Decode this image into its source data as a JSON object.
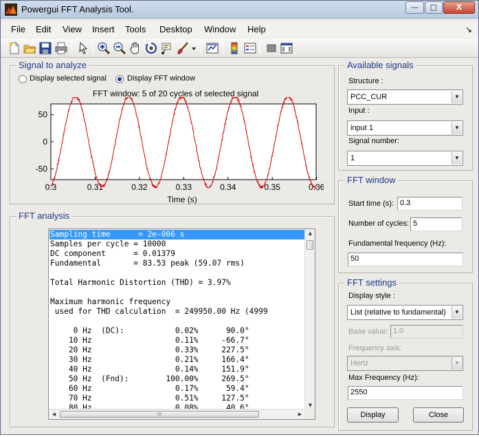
{
  "window": {
    "title": "Powergui FFT Analysis Tool.",
    "min_label": "—",
    "max_label": "□",
    "close_label": "X"
  },
  "menu": [
    "File",
    "Edit",
    "View",
    "Insert",
    "Tools",
    "Desktop",
    "Window",
    "Help"
  ],
  "menu_dock_glyph": "↘",
  "toolbar_icons": [
    "new-figure-icon",
    "open-file-icon",
    "save-icon",
    "print-icon",
    "pointer-icon",
    "zoom-in-icon",
    "zoom-out-icon",
    "pan-hand-icon",
    "rotate-3d-icon",
    "data-cursor-icon",
    "brush-icon",
    "brush-dropdown-icon",
    "link-plot-icon",
    "colorbar-icon",
    "legend-icon",
    "hide-plot-tools-icon",
    "show-plot-tools-icon"
  ],
  "signal_panel": {
    "legend": "Signal to analyze",
    "radio_selected_label": "Display selected signal",
    "radio_fft_label": "Display FFT window",
    "selected_option": "fft",
    "plot_title": "FFT window: 5 of 20 cycles of selected signal",
    "xlabel": "Time (s)"
  },
  "chart_data": {
    "type": "line",
    "title": "FFT window: 5 of 20 cycles of selected signal",
    "xlabel": "Time (s)",
    "ylabel": "",
    "xlim": [
      0.3,
      0.3599
    ],
    "ylim": [
      -70,
      70
    ],
    "xticks": [
      "0.3",
      "0.31",
      "0.32",
      "0.33",
      "0.34",
      "0.35",
      "0.36",
      "0.37",
      "0.38",
      "0.39"
    ],
    "yticks": [
      "-50",
      "0",
      "50"
    ],
    "ytick_values": [
      -50,
      0,
      50
    ],
    "series": [
      {
        "amplitude": 83.53,
        "frequency_hz": 83.33,
        "start_time": 0.3,
        "cycles": 5,
        "color": "#d40000"
      }
    ]
  },
  "fft_panel": {
    "legend": "FFT analysis",
    "lines": [
      "Sampling time      = 2e-006 s",
      "Samples per cycle = 10000",
      "DC component      = 0.01379",
      "Fundamental       = 83.53 peak (59.07 rms)",
      "",
      "Total Harmonic Distortion (THD) = 3.97%",
      "",
      "Maximum harmonic frequency",
      " used for THD calculation  = 249950.00 Hz (4999",
      "",
      "     0 Hz  (DC):           0.02%      90.0°",
      "    10 Hz                  0.11%     -66.7°",
      "    20 Hz                  0.33%     227.5°",
      "    30 Hz                  0.21%     166.4°",
      "    40 Hz                  0.14%     151.9°",
      "    50 Hz  (Fnd):        100.00%     269.5°",
      "    60 Hz                  0.17%      59.4°",
      "    70 Hz                  0.51%     127.5°",
      "    80 Hz                  0.08%      40.6°"
    ],
    "selected_line": 0,
    "hscroll_grip": "III"
  },
  "available_signals": {
    "legend": "Available signals",
    "structure_label": "Structure :",
    "structure_value": "PCC_CUR",
    "input_label": "Input :",
    "input_value": "input 1",
    "signal_number_label": "Signal number:",
    "signal_number_value": "1"
  },
  "fft_window": {
    "legend": "FFT window",
    "start_time_label": "Start time (s):",
    "start_time_value": "0.3",
    "cycles_label": "Number of cycles:",
    "cycles_value": "5",
    "fund_freq_label": "Fundamental frequency (Hz):",
    "fund_freq_value": "50"
  },
  "fft_settings": {
    "legend": "FFT settings",
    "display_style_label": "Display style :",
    "display_style_value": "List (relative to fundamental)",
    "base_value_label": "Base value:",
    "base_value": "1.0",
    "frequency_axis_label": "Frequency axis:",
    "frequency_axis_value": "Hertz",
    "max_freq_label": "Max Frequency (Hz):",
    "max_freq_value": "2550",
    "display_button": "Display",
    "close_button": "Close"
  },
  "colors": {
    "accent": "#1d3a8a",
    "signal": "#d40000",
    "selection": "#3399ff"
  }
}
